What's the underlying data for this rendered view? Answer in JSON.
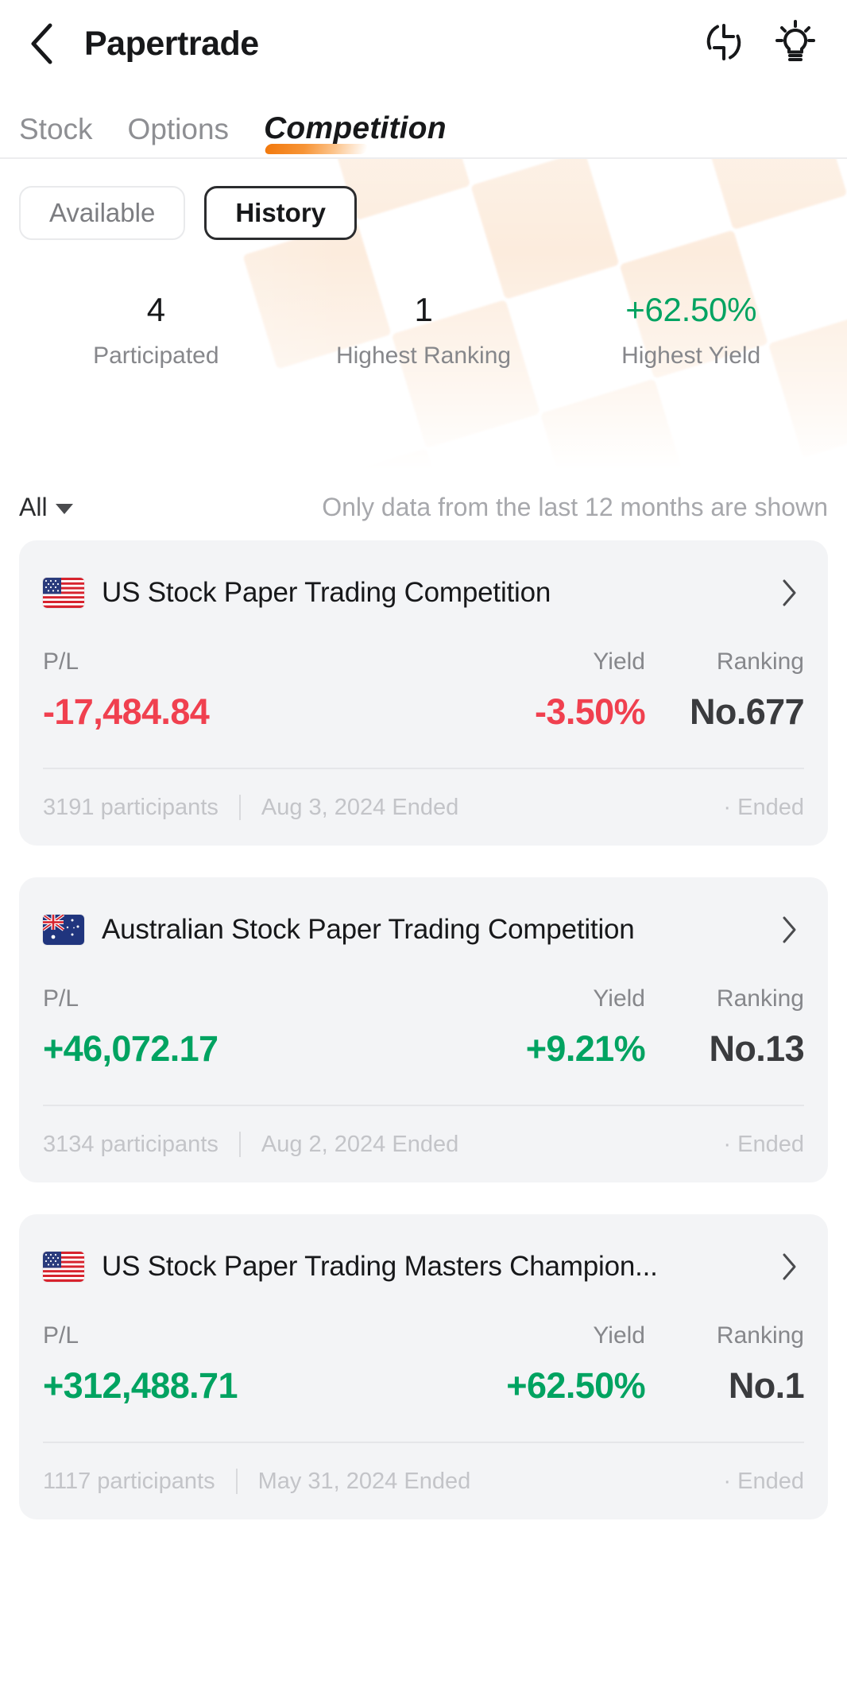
{
  "appbar": {
    "back_icon": "chevron-left-icon",
    "title": "Papertrade",
    "refresh_icon": "refresh-icon",
    "tips_icon": "lightbulb-icon"
  },
  "tabs": [
    {
      "label": "Stock",
      "active": false
    },
    {
      "label": "Options",
      "active": false
    },
    {
      "label": "Competition",
      "active": true
    }
  ],
  "segmented": [
    {
      "label": "Available",
      "active": false
    },
    {
      "label": "History",
      "active": true
    }
  ],
  "stats": [
    {
      "value": "4",
      "label": "Participated",
      "tone": "neutral"
    },
    {
      "value": "1",
      "label": "Highest Ranking",
      "tone": "neutral"
    },
    {
      "value": "+62.50%",
      "label": "Highest Yield",
      "tone": "positive"
    }
  ],
  "filter": {
    "selected": "All",
    "caret_icon": "chevron-down-icon",
    "note": "Only data from the last 12 months are shown"
  },
  "metric_headers": {
    "pl": "P/L",
    "yield": "Yield",
    "ranking": "Ranking"
  },
  "competitions": [
    {
      "flag": "us-flag-icon",
      "title": "US Stock Paper Trading Competition",
      "chevron_icon": "chevron-right-icon",
      "pl": "-17,484.84",
      "pl_tone": "down",
      "yield": "-3.50%",
      "yield_tone": "down",
      "ranking": "No.677",
      "participants": "3191 participants",
      "end_date": "Aug 3, 2024 Ended",
      "status": "· Ended"
    },
    {
      "flag": "au-flag-icon",
      "title": "Australian Stock Paper Trading Competition",
      "chevron_icon": "chevron-right-icon",
      "pl": "+46,072.17",
      "pl_tone": "up",
      "yield": "+9.21%",
      "yield_tone": "up",
      "ranking": "No.13",
      "participants": "3134 participants",
      "end_date": "Aug 2, 2024 Ended",
      "status": "· Ended"
    },
    {
      "flag": "us-flag-icon",
      "title": "US Stock Paper Trading Masters Champion...",
      "chevron_icon": "chevron-right-icon",
      "pl": "+312,488.71",
      "pl_tone": "up",
      "yield": "+62.50%",
      "yield_tone": "up",
      "ranking": "No.1",
      "participants": "1117 participants",
      "end_date": "May 31, 2024 Ended",
      "status": "· Ended"
    }
  ],
  "colors": {
    "accent": "#f2790d",
    "positive": "#00a361",
    "negative": "#f0404f",
    "card_bg": "#f3f4f6",
    "text": "#17181a",
    "muted": "#86878b"
  }
}
